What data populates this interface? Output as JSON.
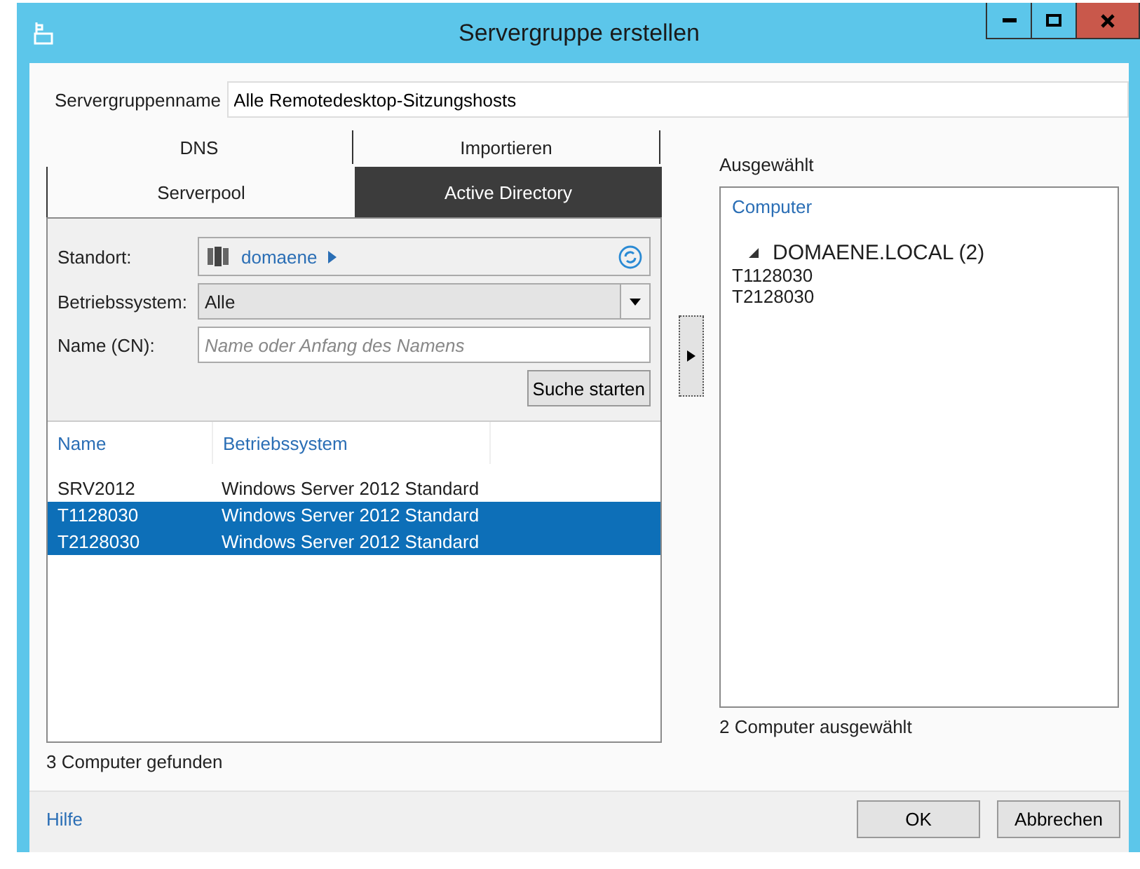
{
  "window": {
    "title": "Servergruppe erstellen"
  },
  "group_name": {
    "label": "Servergruppenname",
    "value": "Alle Remotedesktop-Sitzungshosts"
  },
  "tab_rows": [
    [
      {
        "label": "DNS",
        "selected": false
      },
      {
        "label": "Importieren",
        "selected": false
      }
    ],
    [
      {
        "label": "Serverpool",
        "selected": false
      },
      {
        "label": "Active Directory",
        "selected": true
      }
    ]
  ],
  "search": {
    "location_label": "Standort:",
    "location": "domaene",
    "os_label": "Betriebssystem:",
    "os_value": "Alle",
    "name_label": "Name (CN):",
    "name_placeholder": "Name oder Anfang des Namens",
    "button": "Suche starten"
  },
  "results": {
    "columns": [
      "Name",
      "Betriebssystem"
    ],
    "rows": [
      {
        "name": "SRV2012",
        "os": "Windows Server 2012 Standard",
        "selected": false
      },
      {
        "name": "T1128030",
        "os": "Windows Server 2012 Standard",
        "selected": true
      },
      {
        "name": "T2128030",
        "os": "Windows Server 2012 Standard",
        "selected": true
      }
    ],
    "status": "3 Computer gefunden"
  },
  "selected_panel": {
    "label": "Ausgewählt",
    "column": "Computer",
    "group": {
      "label": "DOMAENE.LOCAL (2)",
      "expanded": true,
      "children": [
        "T1128030",
        "T2128030"
      ]
    },
    "status": "2 Computer ausgewählt"
  },
  "footer": {
    "help": "Hilfe",
    "buttons": [
      "OK",
      "Abbrechen"
    ]
  }
}
